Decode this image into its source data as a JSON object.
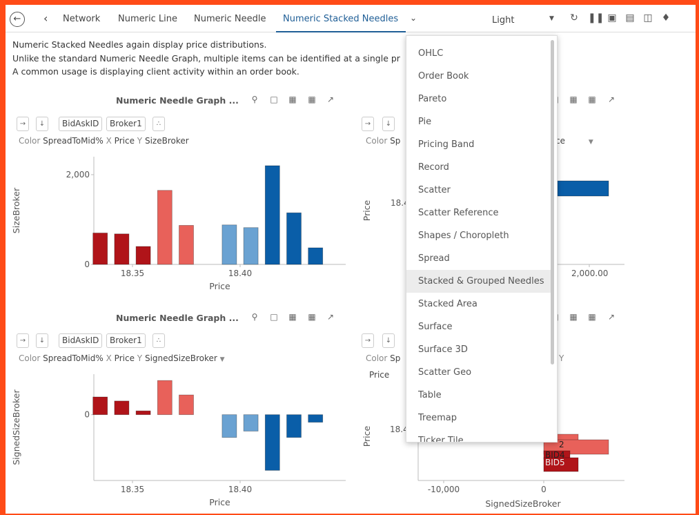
{
  "toolbar": {
    "back_icon": "arrow-left-circle-icon",
    "tabs": [
      {
        "label": "Network"
      },
      {
        "label": "Numeric Line"
      },
      {
        "label": "Numeric Needle"
      },
      {
        "label": "Numeric Stacked Needles"
      }
    ],
    "more_icon": "chevron-down-icon",
    "theme": "Light",
    "icons": [
      "refresh-icon",
      "pause-icon",
      "snapshot-icon",
      "pdf-icon",
      "bookmark-icon",
      "bell-icon"
    ],
    "accent": "#1f5e96"
  },
  "description": [
    "Numeric Stacked Needles again display price distributions.",
    "Unlike the standard Numeric Needle Graph, multiple items can be identified at a single pr",
    "A common usage is displaying client activity within an order book."
  ],
  "panels": {
    "top_left": {
      "title": "Numeric Needle Graph ...",
      "chips": [
        "BidAskID",
        "Broker1"
      ],
      "axis": {
        "color_key": "Color",
        "color_val": "SpreadToMid%",
        "x_key": "X",
        "x_val": "Price",
        "y_key": "Y",
        "y_val": "SizeBroker"
      }
    },
    "top_right": {
      "axis": {
        "color_key": "Color",
        "color_val": "Sp",
        "tail": "ce"
      }
    },
    "bottom_left": {
      "title": "Numeric Needle Graph ...",
      "chips": [
        "BidAskID",
        "Broker1"
      ],
      "axis": {
        "color_key": "Color",
        "color_val": "SpreadToMid%",
        "x_key": "X",
        "x_val": "Price",
        "y_key": "Y",
        "y_val": "SignedSizeBroker"
      }
    },
    "bottom_right": {
      "axis": {
        "color_key": "Color",
        "color_val": "Sp",
        "y_key": "Y",
        "extra": "Price"
      }
    }
  },
  "chart_data": [
    {
      "type": "bar",
      "xlabel": "Price",
      "ylabel": "SizeBroker",
      "x_ticks": [
        "18.35",
        "18.40"
      ],
      "y_ticks": [
        "0",
        "2,000"
      ],
      "ylim": [
        0,
        2400
      ],
      "x": [
        18.335,
        18.345,
        18.355,
        18.365,
        18.375,
        18.395,
        18.405,
        18.415,
        18.425,
        18.435
      ],
      "values": [
        700,
        680,
        400,
        1650,
        870,
        880,
        820,
        2200,
        1150,
        370
      ],
      "colors": [
        "#b01419",
        "#b01419",
        "#b01419",
        "#e8615a",
        "#e8615a",
        "#6aa2d2",
        "#6aa2d2",
        "#0a5ea8",
        "#0a5ea8",
        "#0a5ea8"
      ]
    },
    {
      "type": "bar",
      "orientation": "horizontal",
      "ylabel": "Price",
      "y_ticks": [
        "18.40"
      ],
      "x_ticks": [
        "2,000.00"
      ],
      "values": [
        2000
      ],
      "colors": [
        "#0a5ea8"
      ]
    },
    {
      "type": "bar",
      "xlabel": "Price",
      "ylabel": "SignedSizeBroker",
      "x_ticks": [
        "18.35",
        "18.40"
      ],
      "y_ticks": [
        "0"
      ],
      "ylim": [
        -2600,
        1600
      ],
      "x": [
        18.335,
        18.345,
        18.355,
        18.365,
        18.375,
        18.395,
        18.405,
        18.415,
        18.425,
        18.435
      ],
      "values": [
        700,
        540,
        150,
        1350,
        780,
        -900,
        -650,
        -2200,
        -900,
        -300
      ],
      "colors": [
        "#b01419",
        "#b01419",
        "#b01419",
        "#e8615a",
        "#e8615a",
        "#6aa2d2",
        "#6aa2d2",
        "#0a5ea8",
        "#0a5ea8",
        "#0a5ea8"
      ]
    },
    {
      "type": "bar",
      "orientation": "horizontal",
      "xlabel": "SignedSizeBroker",
      "ylabel": "Price",
      "y_ticks": [
        "18.40"
      ],
      "x_ticks": [
        "-10,000",
        "0"
      ],
      "bar_labels": [
        "2",
        "BID4",
        "BID5"
      ],
      "colors": [
        "#e8615a",
        "#e8615a",
        "#b01419",
        "#b01419"
      ]
    }
  ],
  "dropdown": {
    "items": [
      "OHLC",
      "Order Book",
      "Pareto",
      "Pie",
      "Pricing Band",
      "Record",
      "Scatter",
      "Scatter Reference",
      "Shapes / Choropleth",
      "Spread",
      "Stacked & Grouped Needles",
      "Stacked Area",
      "Surface",
      "Surface 3D",
      "Scatter Geo",
      "Table",
      "Treemap",
      "Ticker Tile"
    ],
    "highlighted": "Stacked & Grouped Needles"
  },
  "panel_icons": [
    "search-icon",
    "selection-icon",
    "excel-icon",
    "table-icon",
    "expand-icon",
    "sort-asc-icon",
    "sort-desc-icon",
    "scatter-icon"
  ]
}
